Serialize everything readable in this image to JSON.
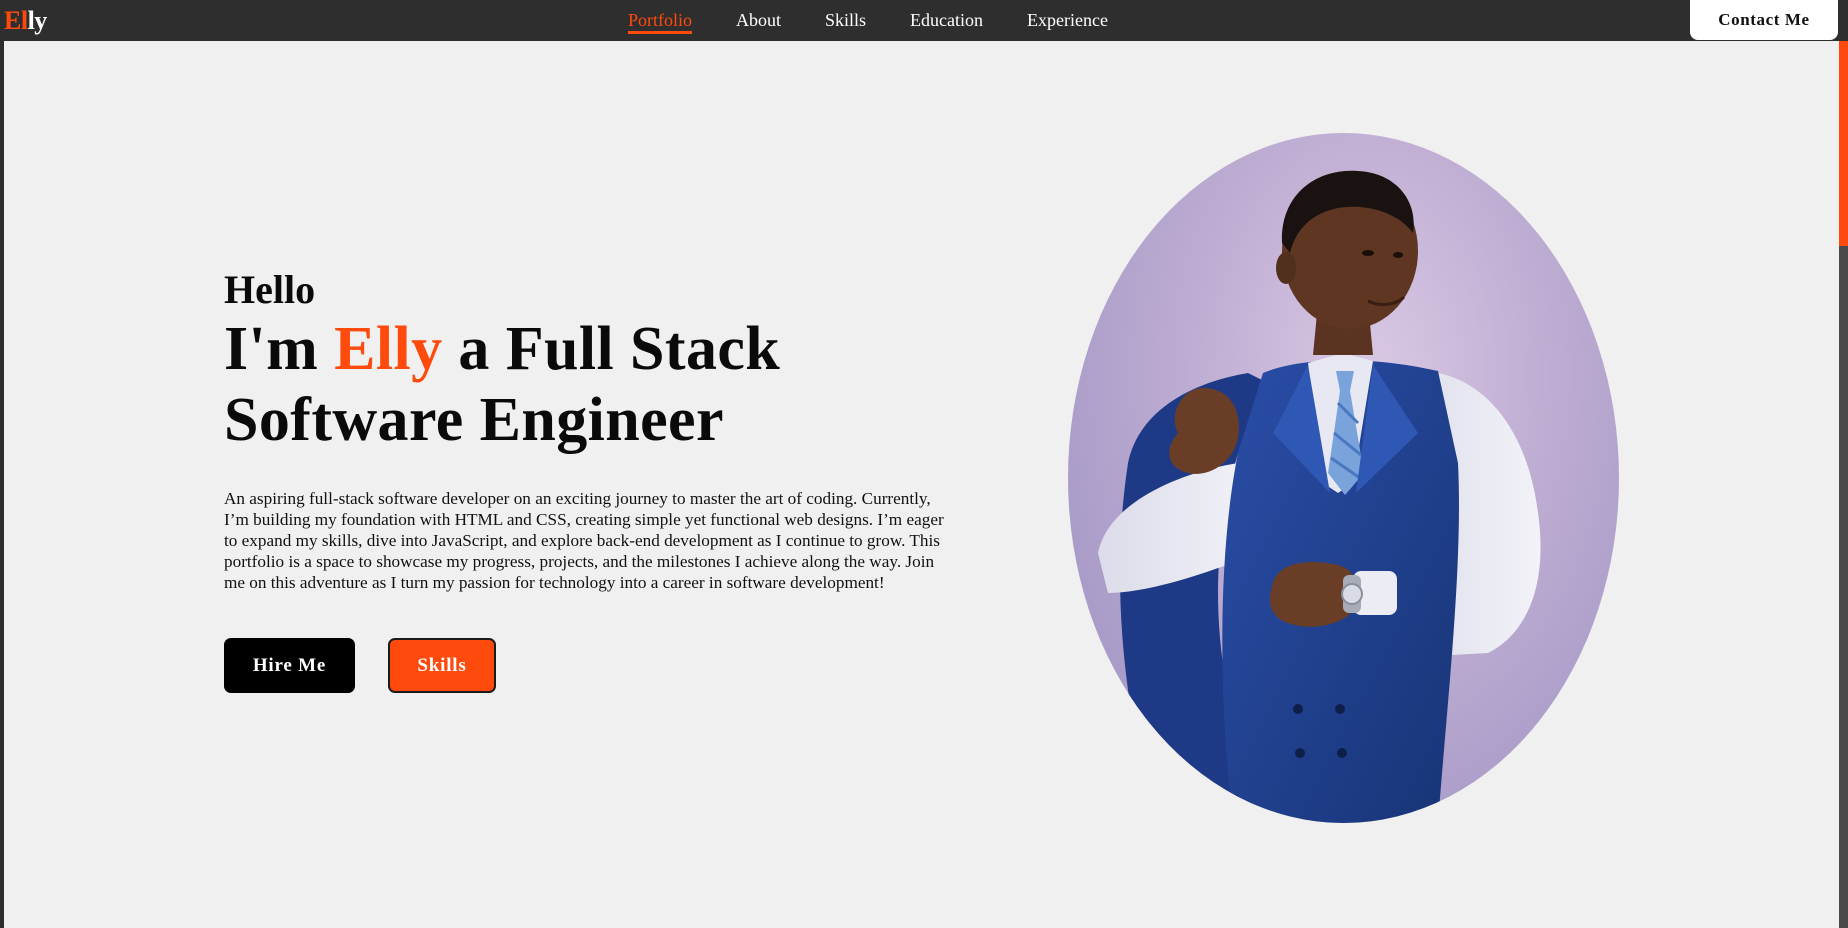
{
  "logo": {
    "accent": "El",
    "rest": "ly"
  },
  "nav": {
    "links": [
      {
        "label": "Portfolio"
      },
      {
        "label": "About"
      },
      {
        "label": "Skills"
      },
      {
        "label": "Education"
      },
      {
        "label": "Experience"
      }
    ],
    "active_index": 0,
    "contact_label": "Contact Me"
  },
  "hero": {
    "greeting": "Hello",
    "headline_prefix": "I'm",
    "name": "Elly",
    "headline_suffix": "a Full Stack",
    "headline_line2": "Software Engineer",
    "bio": "An aspiring full-stack software developer on an exciting journey to master the art of coding. Currently, I’m building my foundation with HTML and CSS, creating simple yet functional web designs. I’m eager to expand my skills, dive into JavaScript, and explore back-end development as I continue to grow. This portfolio is a space to showcase my progress, projects, and the milestones I achieve along the way. Join me on this adventure as I turn my passion for technology into a career in software development!",
    "hire_label": "Hire Me",
    "skills_label": "Skills"
  },
  "colors": {
    "accent": "#ff4a0d",
    "navbar": "#2e2e2e",
    "background": "#f0f0f0",
    "suit": "#1f3f8f",
    "shirt": "#e6e6ee"
  },
  "icons": {
    "portrait": "portrait-photo"
  }
}
